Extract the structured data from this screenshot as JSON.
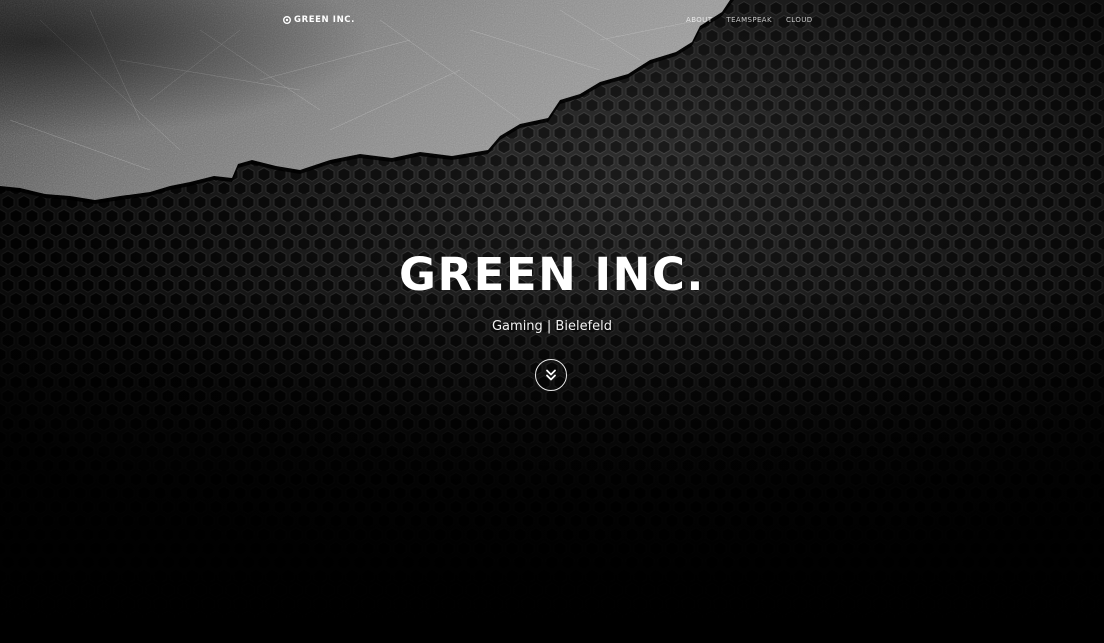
{
  "navbar": {
    "brand_label": "GREEN INC.",
    "brand_icon": "circle-dot-icon",
    "links": [
      {
        "label": "About"
      },
      {
        "label": "Teamspeak"
      },
      {
        "label": "Cloud"
      }
    ]
  },
  "hero": {
    "title": "GREEN INC.",
    "subtitle": "Gaming | Bielefeld",
    "scroll_icon": "double-chevron-down-icon"
  },
  "colors": {
    "background": "#050505",
    "text": "#ffffff",
    "metal": "#8a8a8a"
  }
}
